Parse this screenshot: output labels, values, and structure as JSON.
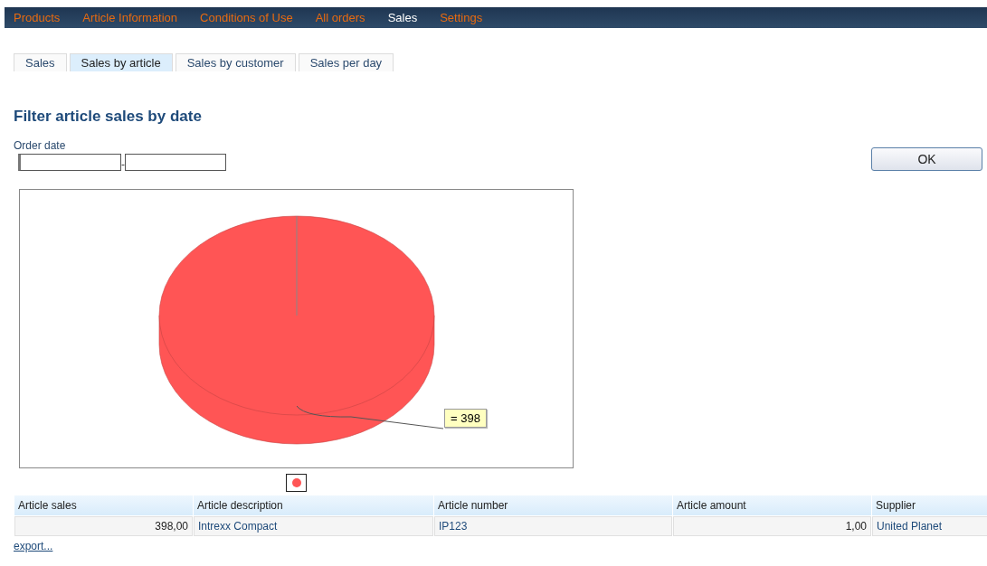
{
  "nav": [
    {
      "label": "Products",
      "selected": false
    },
    {
      "label": "Article Information",
      "selected": false
    },
    {
      "label": "Conditions of Use",
      "selected": false
    },
    {
      "label": "All orders",
      "selected": false
    },
    {
      "label": "Sales",
      "selected": true
    },
    {
      "label": "Settings",
      "selected": false
    }
  ],
  "tabs": [
    {
      "label": "Sales",
      "selected": false
    },
    {
      "label": "Sales by article",
      "selected": true
    },
    {
      "label": "Sales by customer",
      "selected": false
    },
    {
      "label": "Sales per day",
      "selected": false
    }
  ],
  "heading": "Filter article sales by date",
  "filter": {
    "label": "Order date",
    "separator": "-",
    "button": "OK"
  },
  "chart": {
    "value_label": "= 398"
  },
  "table": {
    "columns": [
      "Article sales",
      "Article description",
      "Article number",
      "Article amount",
      "Supplier"
    ],
    "rows": [
      [
        "398,00",
        "Intrexx Compact",
        "IP123",
        "1,00",
        "United Planet"
      ]
    ]
  },
  "export": "export..."
}
